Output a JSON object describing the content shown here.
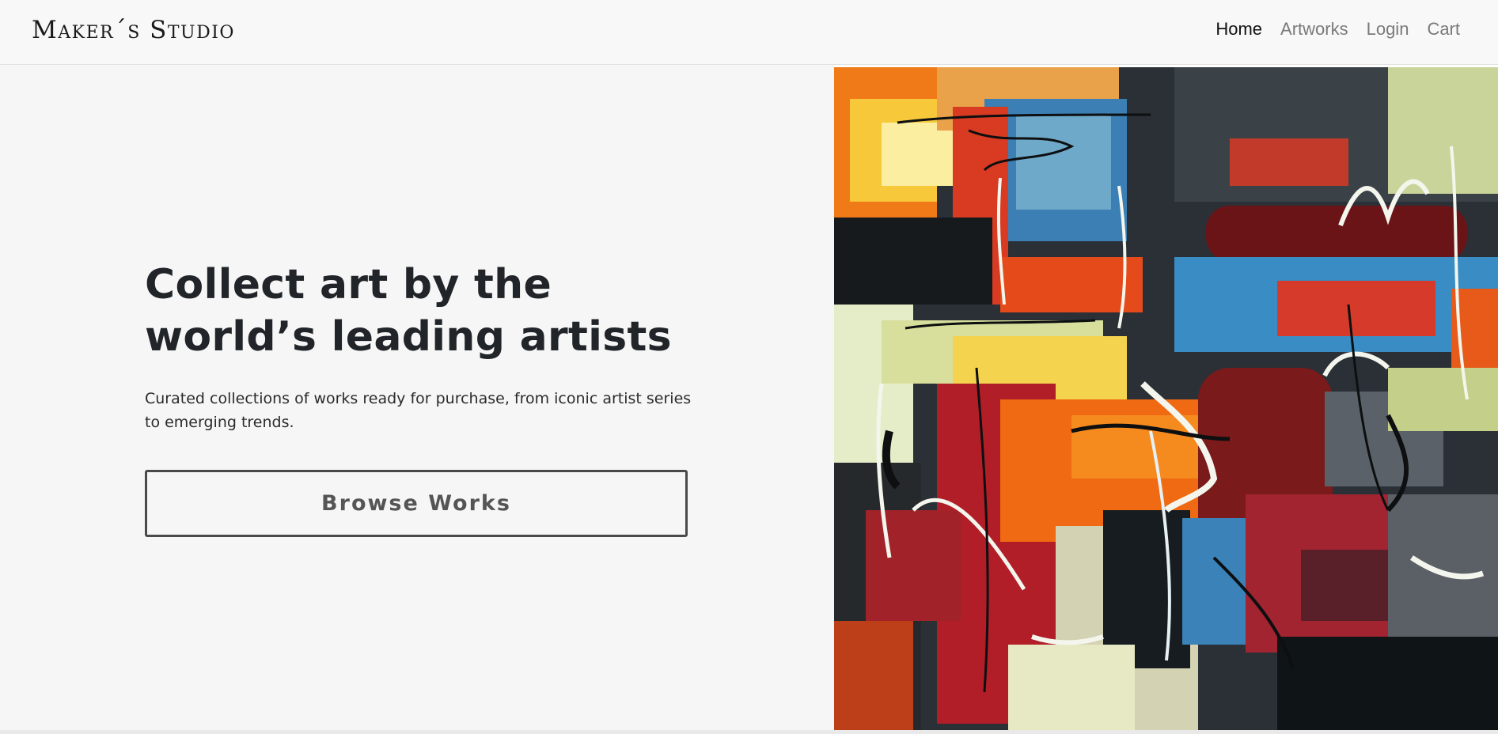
{
  "brand": {
    "name": "Maker´s Studio"
  },
  "nav": {
    "items": [
      {
        "label": "Home",
        "active": true
      },
      {
        "label": "Artworks",
        "active": false
      },
      {
        "label": "Login",
        "active": false
      },
      {
        "label": "Cart",
        "active": false
      }
    ]
  },
  "hero": {
    "headline": "Collect art by the world’s leading artists",
    "subtitle": "Curated collections of works ready for purchase, from iconic artist series to emerging trends.",
    "button_label": "Browse Works",
    "image_icon": "abstract-painting-image"
  },
  "colors": {
    "background": "#f6f6f6",
    "text": "#212529",
    "nav_active": "#111111",
    "nav_inactive": "#7a7a7a",
    "button_border": "#4a4a4a"
  }
}
